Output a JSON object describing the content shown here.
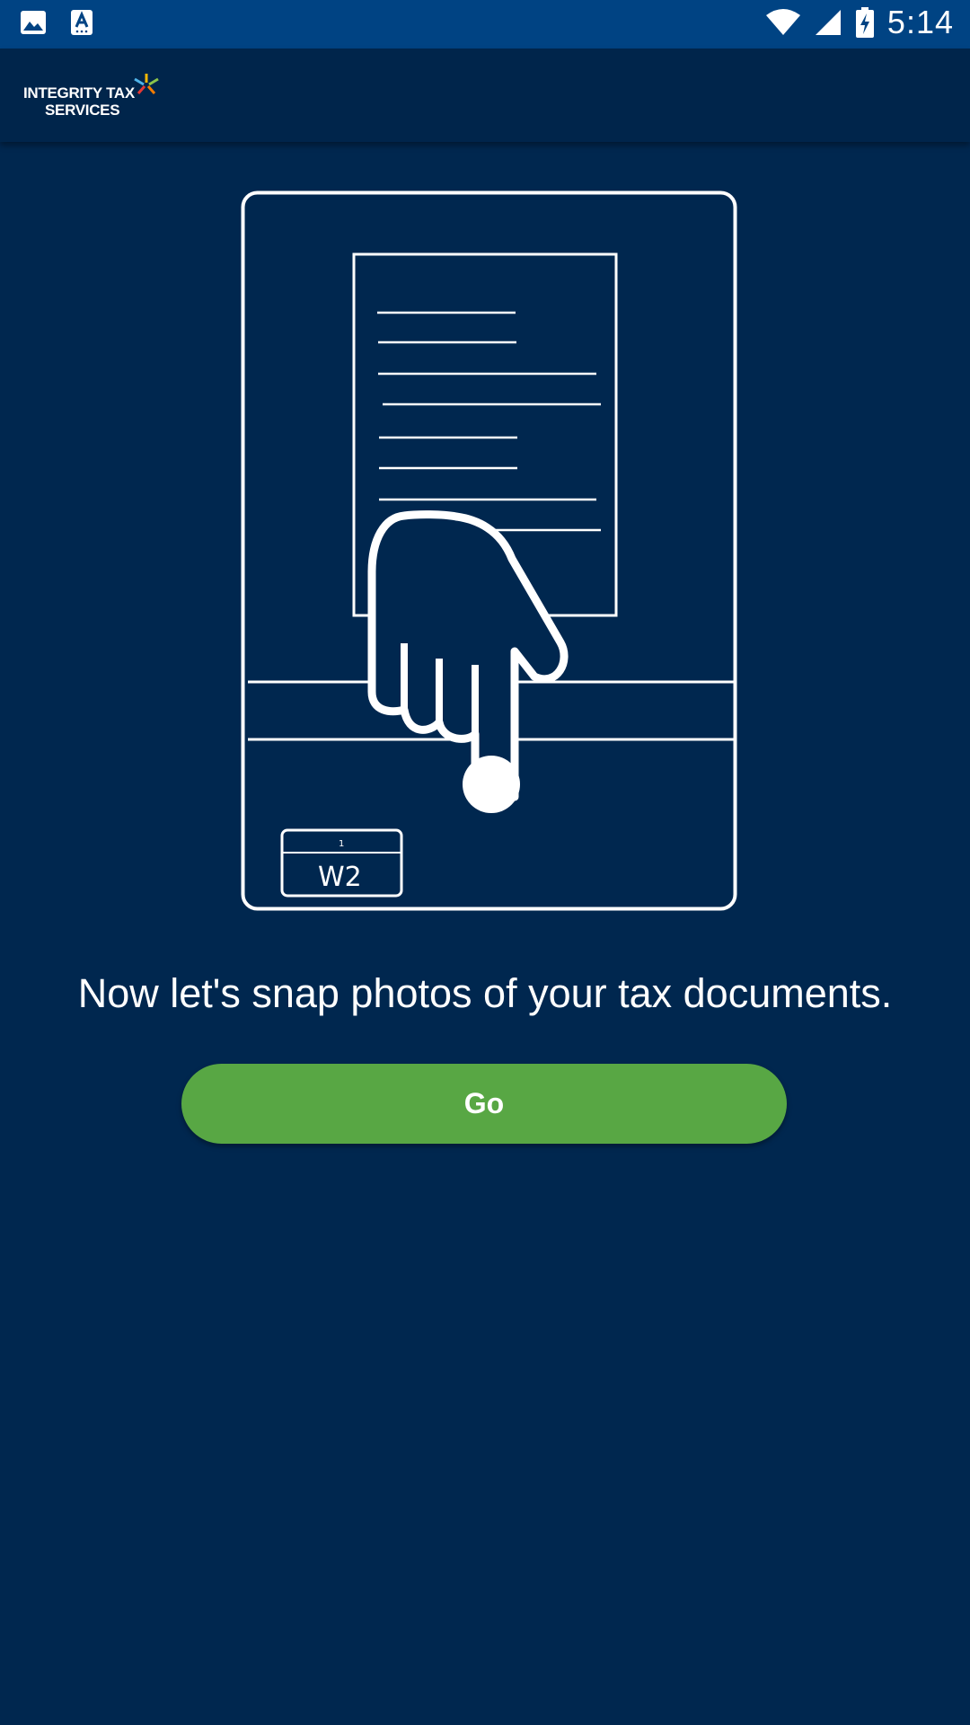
{
  "status_bar": {
    "time": "5:14",
    "left_icons": [
      "image-icon",
      "text-recognition-icon"
    ],
    "right_icons": [
      "wifi-icon",
      "cell-signal-icon",
      "battery-charging-icon"
    ]
  },
  "app_bar": {
    "logo_line1": "INTEGRITY TAX",
    "logo_line2": "SERVICES"
  },
  "illustration": {
    "form_label": "W2",
    "card_label": "W2",
    "card_number": "1"
  },
  "main": {
    "headline": "Now let's snap photos of your tax documents.",
    "go_label": "Go"
  },
  "colors": {
    "background": "#00274f",
    "status_bar": "#004383",
    "app_bar": "#00254b",
    "button": "#58a744"
  }
}
